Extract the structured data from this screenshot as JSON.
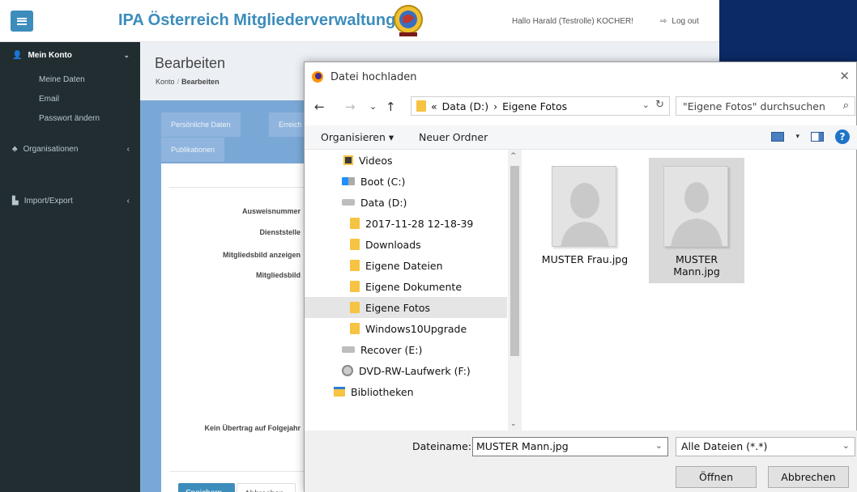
{
  "app": {
    "title": "IPA Österreich Mitgliederverwaltung",
    "greeting": "Hallo Harald (Testrolle) KOCHER!",
    "logout_label": "Log out",
    "accent_color": "#3c8dbc"
  },
  "sidebar": {
    "section_title": "Mein Konto",
    "sub_items": [
      "Meine Daten",
      "Email",
      "Passwort ändern"
    ],
    "items": [
      {
        "label": "Organisationen",
        "icon": "sitemap-icon"
      },
      {
        "label": "Import/Export",
        "icon": "file-icon"
      }
    ]
  },
  "main": {
    "page_title": "Bearbeiten",
    "breadcrumb_root": "Konto",
    "breadcrumb_current": "Bearbeiten",
    "tabs": [
      "Persönliche Daten",
      "Erreich",
      "Publikationen"
    ],
    "form_labels": [
      "Ausweisnummer",
      "Dienststelle",
      "Mitgliedsbild anzeigen",
      "Mitgliedsbild",
      "Kein Übertrag auf Folgejahr"
    ],
    "save_label": "Speichern",
    "cancel_label": "Abbrechen"
  },
  "dialog": {
    "title": "Datei hochladen",
    "address_prefix": "«",
    "address_parts": [
      "Data (D:)",
      "Eigene Fotos"
    ],
    "search_placeholder": "\"Eigene Fotos\" durchsuchen",
    "toolbar": {
      "organize": "Organisieren ▾",
      "new_folder": "Neuer Ordner"
    },
    "tree": [
      {
        "label": "Videos",
        "icon": "videos-folder-icon",
        "level": 1
      },
      {
        "label": "Boot (C:)",
        "icon": "windows-drive-icon",
        "level": 1
      },
      {
        "label": "Data (D:)",
        "icon": "drive-icon",
        "level": 1
      },
      {
        "label": "2017-11-28 12-18-39",
        "icon": "folder-icon",
        "level": 2
      },
      {
        "label": "Downloads",
        "icon": "folder-icon",
        "level": 2
      },
      {
        "label": "Eigene Dateien",
        "icon": "folder-icon",
        "level": 2
      },
      {
        "label": "Eigene Dokumente",
        "icon": "folder-icon",
        "level": 2
      },
      {
        "label": "Eigene Fotos",
        "icon": "folder-icon",
        "level": 2,
        "selected": true
      },
      {
        "label": "Windows10Upgrade",
        "icon": "folder-icon",
        "level": 2
      },
      {
        "label": "Recover (E:)",
        "icon": "drive-icon",
        "level": 1
      },
      {
        "label": "DVD-RW-Laufwerk (F:)",
        "icon": "dvd-drive-icon",
        "level": 1
      },
      {
        "label": "Bibliotheken",
        "icon": "libraries-icon",
        "level": 0
      }
    ],
    "files": [
      {
        "name": "MUSTER Frau.jpg",
        "selected": false
      },
      {
        "name": "MUSTER Mann.jpg",
        "selected": true
      }
    ],
    "filename_label": "Dateiname:",
    "filename_value": "MUSTER Mann.jpg",
    "filetype_value": "Alle Dateien (*.*)",
    "open_label": "Öffnen",
    "cancel_label": "Abbrechen"
  }
}
